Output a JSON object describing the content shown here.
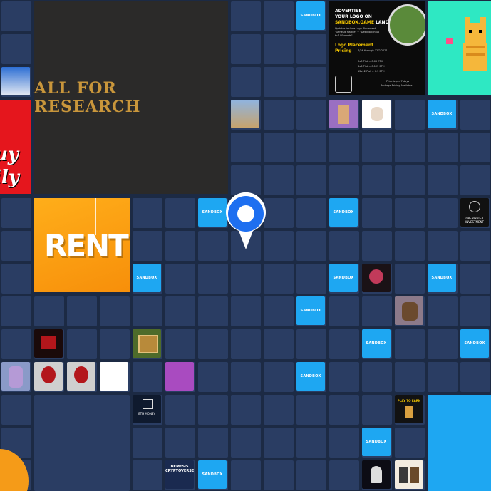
{
  "colors": {
    "background": "#1c2a44",
    "cell": "#2a3d63",
    "sandbox_blue": "#1ea7f2",
    "pin_blue": "#1e6ff0"
  },
  "sandbox_label": "SANDBOX",
  "research_label": "ALL FOR RESEARCH",
  "rent_label": "RENT",
  "left_red_text": [
    "uy",
    "ily"
  ],
  "ad": {
    "line1": "ADVERTISE",
    "line2": "YOUR LOGO ON",
    "line3": "SANDBOX.GAME",
    "line3b": "LAND",
    "desc": "Updates include Logo Placement, \"Genesis Plaque\" + \"Description up to 100 words\"",
    "pricing_title1": "Logo Placement",
    "pricing_title2": "Pricing",
    "pricing_range": "7/26 through 12/2 2021",
    "price1": "3x3 Plot = 0.05 ETH",
    "price2": "6x6 Plot = 0.125 ETH",
    "price3": "12x12 Plot = 0.3 ETH",
    "note1": "Price is per 7 days",
    "note2": "Package Pricing Available"
  },
  "tiles": {
    "openwater": "OPENWATER INVESTMENT",
    "ethmoney": "ETH MONEY",
    "nemesis": "NEMESIS CRYPTOVERSE",
    "play_to_earn": "PLAY TO EARN"
  },
  "pin_icon": "location-pin-icon"
}
